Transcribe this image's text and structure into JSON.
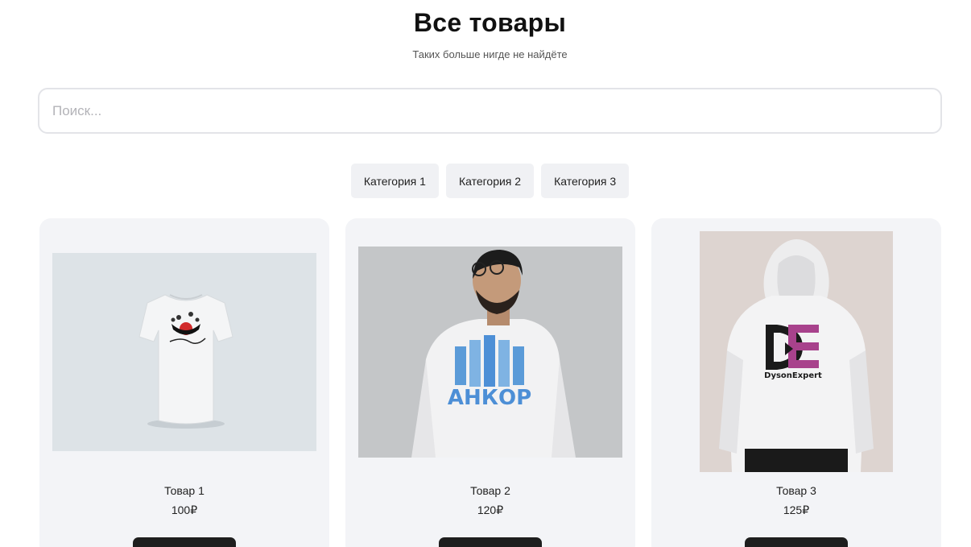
{
  "header": {
    "title": "Все товары",
    "subtitle": "Таких больше нигде не найдёте"
  },
  "search": {
    "placeholder": "Поиск...",
    "value": ""
  },
  "categories": [
    {
      "label": "Категория 1"
    },
    {
      "label": "Категория 2"
    },
    {
      "label": "Категория 3"
    }
  ],
  "products": [
    {
      "name": "Товар 1",
      "price": "100₽",
      "image": "white t-shirt with printed logo"
    },
    {
      "name": "Товар 2",
      "price": "120₽",
      "image": "man in white sweatshirt with АНКОР logo",
      "print_text": "АНКОР"
    },
    {
      "name": "Товар 3",
      "price": "125₽",
      "image": "white hoodie back with DysonExpert logo",
      "print_text": "DysonExpert"
    }
  ],
  "colors": {
    "card_bg": "#f3f4f7",
    "button_bg": "#1e1e1e",
    "category_bg": "#f0f1f4",
    "accent_purple": "#a8428c",
    "ankor_blue": "#4d8fd6"
  }
}
